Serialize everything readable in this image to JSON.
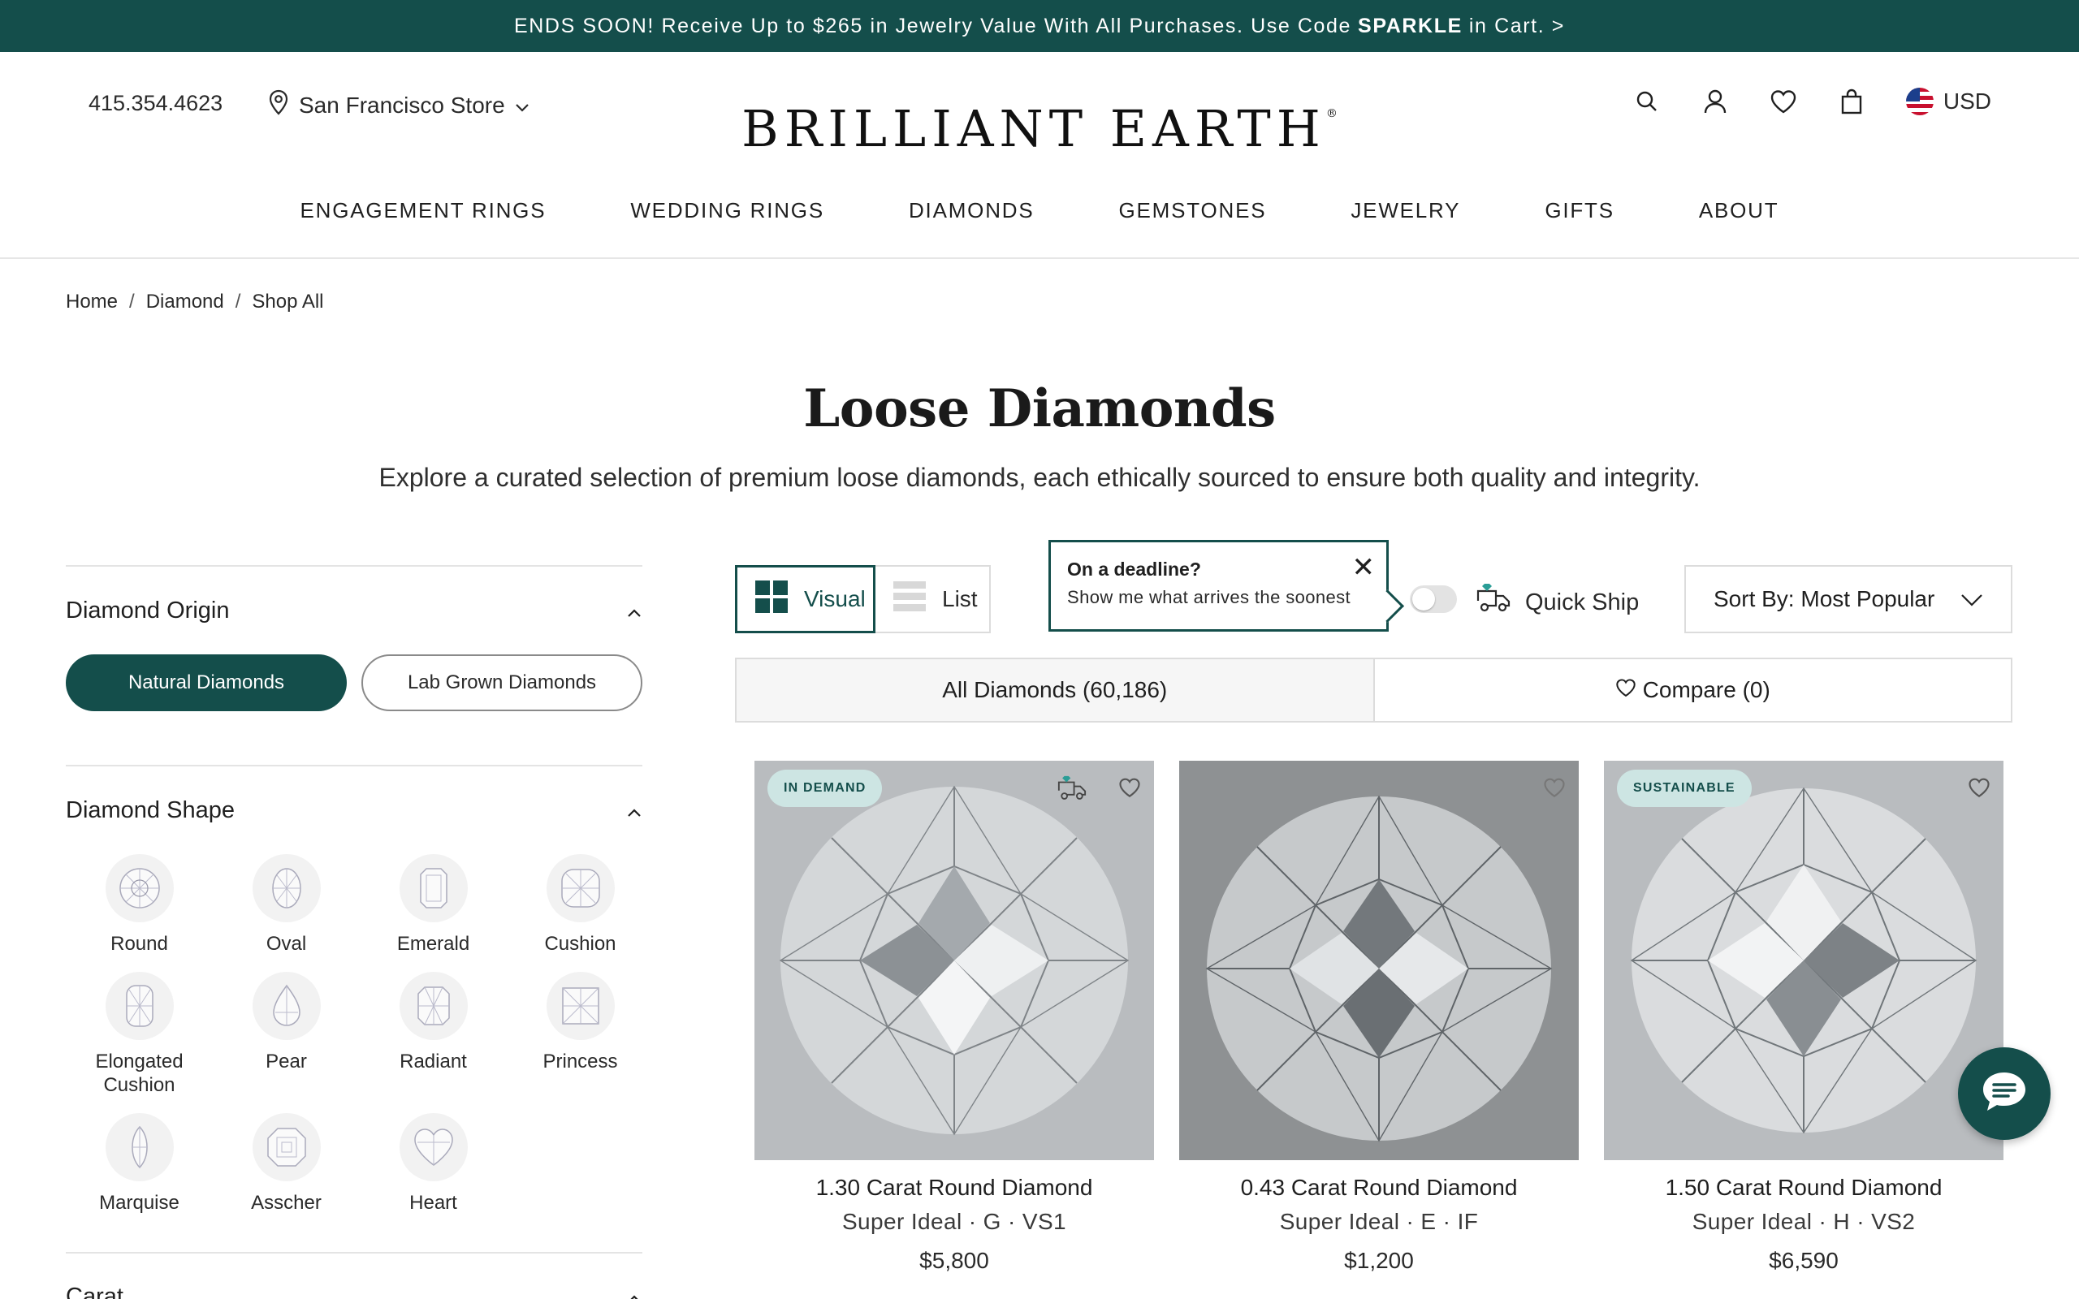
{
  "promo": {
    "text_before": "ENDS SOON! Receive Up to $265 in Jewelry Value With All Purchases. Use Code",
    "code": "SPARKLE",
    "text_after": "in Cart. >"
  },
  "header": {
    "phone": "415.354.4623",
    "store": "San Francisco Store",
    "logo": "BRILLIANT EARTH",
    "logo_mark": "®",
    "currency": "USD"
  },
  "nav": [
    "ENGAGEMENT RINGS",
    "WEDDING RINGS",
    "DIAMONDS",
    "GEMSTONES",
    "JEWELRY",
    "GIFTS",
    "ABOUT"
  ],
  "breadcrumb": [
    "Home",
    "Diamond",
    "Shop All"
  ],
  "page": {
    "title": "Loose Diamonds",
    "subtitle": "Explore a curated selection of premium loose diamonds, each ethically sourced to ensure both quality and integrity."
  },
  "filters": {
    "origin": {
      "title": "Diamond Origin",
      "options": [
        "Natural Diamonds",
        "Lab Grown Diamonds"
      ],
      "selected": "Natural Diamonds"
    },
    "shape": {
      "title": "Diamond Shape",
      "options": [
        "Round",
        "Oval",
        "Emerald",
        "Cushion",
        "Elongated Cushion",
        "Pear",
        "Radiant",
        "Princess",
        "Marquise",
        "Asscher",
        "Heart"
      ]
    },
    "carat": {
      "title": "Carat"
    }
  },
  "toolbar": {
    "view_visual": "Visual",
    "view_list": "List",
    "tooltip_title": "On a deadline?",
    "tooltip_body": "Show me what arrives the soonest",
    "quick_ship": "Quick Ship",
    "sort": "Sort By: Most Popular",
    "tab_all": "All Diamonds (60,186)",
    "tab_compare": "Compare (0)"
  },
  "products": [
    {
      "badge": "IN DEMAND",
      "name": "1.30 Carat Round Diamond",
      "spec": "Super Ideal · G · VS1",
      "price": "$5,800",
      "bg": "#b9bcbf"
    },
    {
      "badge": "",
      "name": "0.43 Carat Round Diamond",
      "spec": "Super Ideal · E · IF",
      "price": "$1,200",
      "bg": "#8e9193"
    },
    {
      "badge": "SUSTAINABLE",
      "name": "1.50 Carat Round Diamond",
      "spec": "Super Ideal · H · VS2",
      "price": "$6,590",
      "bg": "#b9bcbf"
    }
  ],
  "colors": {
    "brand": "#144e4b",
    "badge_bg": "#cde5e3"
  }
}
